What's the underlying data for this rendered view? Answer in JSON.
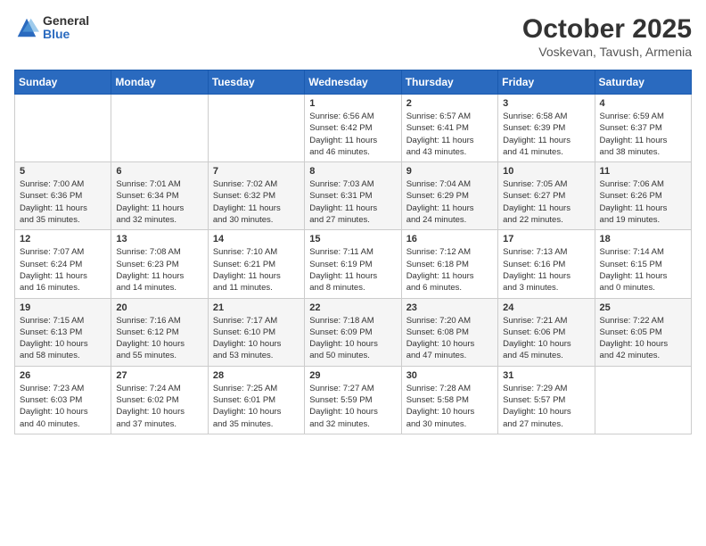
{
  "header": {
    "logo_general": "General",
    "logo_blue": "Blue",
    "title": "October 2025",
    "subtitle": "Voskevan, Tavush, Armenia"
  },
  "weekdays": [
    "Sunday",
    "Monday",
    "Tuesday",
    "Wednesday",
    "Thursday",
    "Friday",
    "Saturday"
  ],
  "weeks": [
    [
      {
        "day": "",
        "info": ""
      },
      {
        "day": "",
        "info": ""
      },
      {
        "day": "",
        "info": ""
      },
      {
        "day": "1",
        "info": "Sunrise: 6:56 AM\nSunset: 6:42 PM\nDaylight: 11 hours\nand 46 minutes."
      },
      {
        "day": "2",
        "info": "Sunrise: 6:57 AM\nSunset: 6:41 PM\nDaylight: 11 hours\nand 43 minutes."
      },
      {
        "day": "3",
        "info": "Sunrise: 6:58 AM\nSunset: 6:39 PM\nDaylight: 11 hours\nand 41 minutes."
      },
      {
        "day": "4",
        "info": "Sunrise: 6:59 AM\nSunset: 6:37 PM\nDaylight: 11 hours\nand 38 minutes."
      }
    ],
    [
      {
        "day": "5",
        "info": "Sunrise: 7:00 AM\nSunset: 6:36 PM\nDaylight: 11 hours\nand 35 minutes."
      },
      {
        "day": "6",
        "info": "Sunrise: 7:01 AM\nSunset: 6:34 PM\nDaylight: 11 hours\nand 32 minutes."
      },
      {
        "day": "7",
        "info": "Sunrise: 7:02 AM\nSunset: 6:32 PM\nDaylight: 11 hours\nand 30 minutes."
      },
      {
        "day": "8",
        "info": "Sunrise: 7:03 AM\nSunset: 6:31 PM\nDaylight: 11 hours\nand 27 minutes."
      },
      {
        "day": "9",
        "info": "Sunrise: 7:04 AM\nSunset: 6:29 PM\nDaylight: 11 hours\nand 24 minutes."
      },
      {
        "day": "10",
        "info": "Sunrise: 7:05 AM\nSunset: 6:27 PM\nDaylight: 11 hours\nand 22 minutes."
      },
      {
        "day": "11",
        "info": "Sunrise: 7:06 AM\nSunset: 6:26 PM\nDaylight: 11 hours\nand 19 minutes."
      }
    ],
    [
      {
        "day": "12",
        "info": "Sunrise: 7:07 AM\nSunset: 6:24 PM\nDaylight: 11 hours\nand 16 minutes."
      },
      {
        "day": "13",
        "info": "Sunrise: 7:08 AM\nSunset: 6:23 PM\nDaylight: 11 hours\nand 14 minutes."
      },
      {
        "day": "14",
        "info": "Sunrise: 7:10 AM\nSunset: 6:21 PM\nDaylight: 11 hours\nand 11 minutes."
      },
      {
        "day": "15",
        "info": "Sunrise: 7:11 AM\nSunset: 6:19 PM\nDaylight: 11 hours\nand 8 minutes."
      },
      {
        "day": "16",
        "info": "Sunrise: 7:12 AM\nSunset: 6:18 PM\nDaylight: 11 hours\nand 6 minutes."
      },
      {
        "day": "17",
        "info": "Sunrise: 7:13 AM\nSunset: 6:16 PM\nDaylight: 11 hours\nand 3 minutes."
      },
      {
        "day": "18",
        "info": "Sunrise: 7:14 AM\nSunset: 6:15 PM\nDaylight: 11 hours\nand 0 minutes."
      }
    ],
    [
      {
        "day": "19",
        "info": "Sunrise: 7:15 AM\nSunset: 6:13 PM\nDaylight: 10 hours\nand 58 minutes."
      },
      {
        "day": "20",
        "info": "Sunrise: 7:16 AM\nSunset: 6:12 PM\nDaylight: 10 hours\nand 55 minutes."
      },
      {
        "day": "21",
        "info": "Sunrise: 7:17 AM\nSunset: 6:10 PM\nDaylight: 10 hours\nand 53 minutes."
      },
      {
        "day": "22",
        "info": "Sunrise: 7:18 AM\nSunset: 6:09 PM\nDaylight: 10 hours\nand 50 minutes."
      },
      {
        "day": "23",
        "info": "Sunrise: 7:20 AM\nSunset: 6:08 PM\nDaylight: 10 hours\nand 47 minutes."
      },
      {
        "day": "24",
        "info": "Sunrise: 7:21 AM\nSunset: 6:06 PM\nDaylight: 10 hours\nand 45 minutes."
      },
      {
        "day": "25",
        "info": "Sunrise: 7:22 AM\nSunset: 6:05 PM\nDaylight: 10 hours\nand 42 minutes."
      }
    ],
    [
      {
        "day": "26",
        "info": "Sunrise: 7:23 AM\nSunset: 6:03 PM\nDaylight: 10 hours\nand 40 minutes."
      },
      {
        "day": "27",
        "info": "Sunrise: 7:24 AM\nSunset: 6:02 PM\nDaylight: 10 hours\nand 37 minutes."
      },
      {
        "day": "28",
        "info": "Sunrise: 7:25 AM\nSunset: 6:01 PM\nDaylight: 10 hours\nand 35 minutes."
      },
      {
        "day": "29",
        "info": "Sunrise: 7:27 AM\nSunset: 5:59 PM\nDaylight: 10 hours\nand 32 minutes."
      },
      {
        "day": "30",
        "info": "Sunrise: 7:28 AM\nSunset: 5:58 PM\nDaylight: 10 hours\nand 30 minutes."
      },
      {
        "day": "31",
        "info": "Sunrise: 7:29 AM\nSunset: 5:57 PM\nDaylight: 10 hours\nand 27 minutes."
      },
      {
        "day": "",
        "info": ""
      }
    ]
  ]
}
